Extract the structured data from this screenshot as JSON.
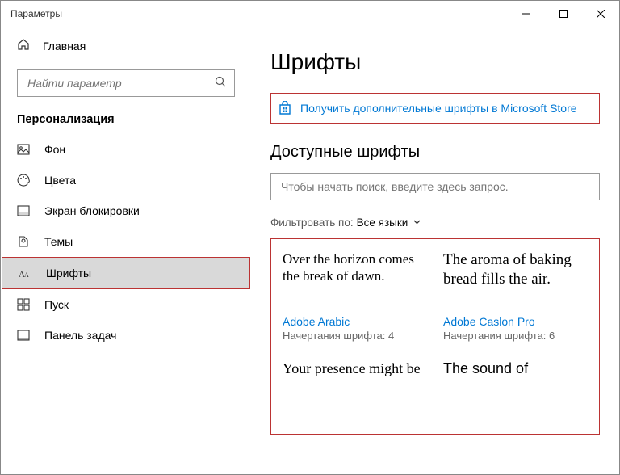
{
  "window": {
    "title": "Параметры"
  },
  "sidebar": {
    "home": "Главная",
    "search_placeholder": "Найти параметр",
    "section": "Персонализация",
    "items": [
      {
        "label": "Фон"
      },
      {
        "label": "Цвета"
      },
      {
        "label": "Экран блокировки"
      },
      {
        "label": "Темы"
      },
      {
        "label": "Шрифты"
      },
      {
        "label": "Пуск"
      },
      {
        "label": "Панель задач"
      }
    ]
  },
  "main": {
    "title": "Шрифты",
    "store_link": "Получить дополнительные шрифты в Microsoft Store",
    "available": "Доступные шрифты",
    "font_search_placeholder": "Чтобы начать поиск, введите здесь запрос.",
    "filter_label": "Фильтровать по:",
    "filter_value": "Все языки",
    "fonts": [
      {
        "sample": "Over the horizon comes the break of dawn.",
        "name": "Adobe Arabic",
        "faces_label": "Начертания шрифта:",
        "faces": "4"
      },
      {
        "sample": "The aroma of baking bread fills the air.",
        "name": "Adobe Caslon Pro",
        "faces_label": "Начертания шрифта:",
        "faces": "6"
      },
      {
        "sample": "Your presence might be",
        "name": "",
        "faces_label": "",
        "faces": ""
      },
      {
        "sample": "The sound of",
        "name": "",
        "faces_label": "",
        "faces": ""
      }
    ]
  }
}
